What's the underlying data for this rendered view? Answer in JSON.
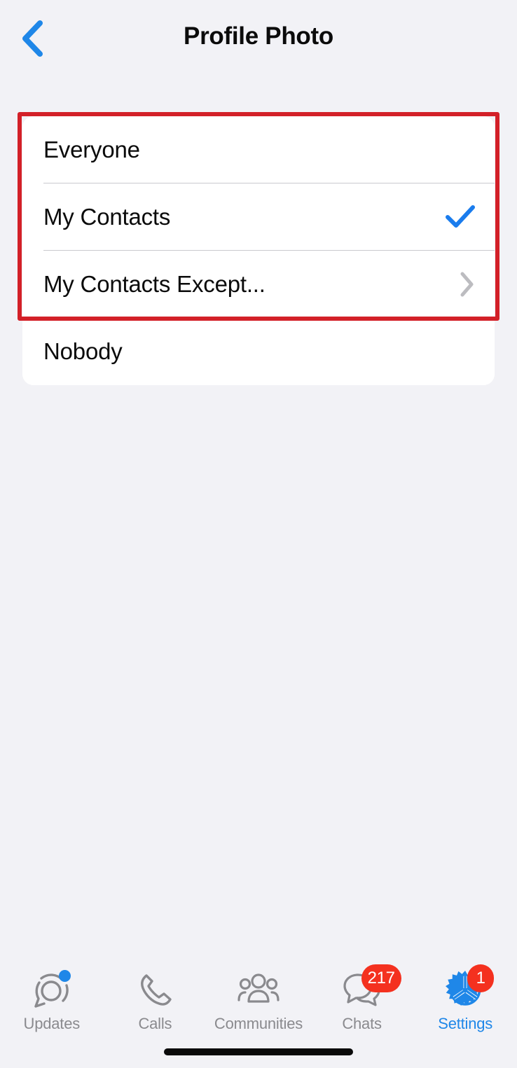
{
  "header": {
    "title": "Profile Photo",
    "back_icon": "chevron-left-icon"
  },
  "colors": {
    "accent_blue": "#1f87e8",
    "annotation_red": "#d32028",
    "badge_red": "#f4311f",
    "page_background": "#f2f2f6",
    "card_background": "#ffffff",
    "separator": "#c9c9ce",
    "primary_text": "#0b0b0b",
    "inactive_tab": "#8a8a8e"
  },
  "privacy_options": {
    "selected": "My Contacts",
    "rows": [
      {
        "label": "Everyone",
        "accessory": "none",
        "selected": false,
        "highlighted": true
      },
      {
        "label": "My Contacts",
        "accessory": "checkmark-icon",
        "selected": true,
        "highlighted": true
      },
      {
        "label": "My Contacts Except...",
        "accessory": "chevron-right-icon",
        "selected": false,
        "highlighted": true
      },
      {
        "label": "Nobody",
        "accessory": "none",
        "selected": false,
        "highlighted": false
      }
    ]
  },
  "annotation": {
    "shape": "rectangle",
    "color": "#d32028",
    "covers": "Everyone / My Contacts / My Contacts Except..."
  },
  "tab_bar": {
    "active": "Settings",
    "tabs": [
      {
        "label": "Updates",
        "icon": "updates-ring-icon",
        "badge": "",
        "dot": true
      },
      {
        "label": "Calls",
        "icon": "phone-icon",
        "badge": "",
        "dot": false
      },
      {
        "label": "Communities",
        "icon": "people-group-icon",
        "badge": "",
        "dot": false
      },
      {
        "label": "Chats",
        "icon": "chat-bubbles-icon",
        "badge": "217",
        "dot": false
      },
      {
        "label": "Settings",
        "icon": "gear-icon",
        "badge": "1",
        "dot": false
      }
    ]
  },
  "home_indicator": {
    "visible": true
  }
}
